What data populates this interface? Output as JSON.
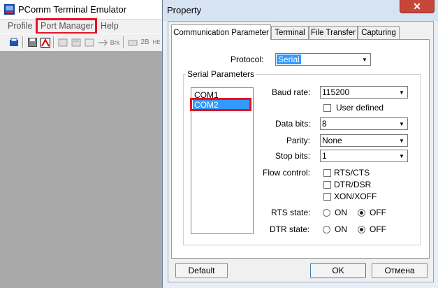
{
  "app": {
    "title": "PComm Terminal Emulator",
    "menu": [
      "Profile",
      "Port Manager",
      "Help"
    ],
    "toolbar": {
      "brk_label": "Brk",
      "twob_label": "2B",
      "he_label": "HE"
    }
  },
  "dialog": {
    "title": "Property",
    "close_glyph": "✕",
    "tabs": [
      "Communication Parameter",
      "Terminal",
      "File Transfer",
      "Capturing"
    ],
    "protocol": {
      "label": "Protocol:",
      "value": "Serial"
    },
    "serial_group_label": "Serial Parameters",
    "ports": [
      "COM1",
      "COM2"
    ],
    "selected_port": "COM2",
    "baud_rate": {
      "label": "Baud rate:",
      "value": "115200"
    },
    "user_defined_label": "User defined",
    "data_bits": {
      "label": "Data bits:",
      "value": "8"
    },
    "parity": {
      "label": "Parity:",
      "value": "None"
    },
    "stop_bits": {
      "label": "Stop bits:",
      "value": "1"
    },
    "flow_control": {
      "label": "Flow control:",
      "options": [
        "RTS/CTS",
        "DTR/DSR",
        "XON/XOFF"
      ]
    },
    "rts_state": {
      "label": "RTS state:",
      "on": "ON",
      "off": "OFF",
      "selected": "OFF"
    },
    "dtr_state": {
      "label": "DTR state:",
      "on": "ON",
      "off": "OFF",
      "selected": "OFF"
    },
    "buttons": {
      "default": "Default",
      "ok": "OK",
      "cancel": "Отмена"
    }
  },
  "colors": {
    "highlight": "#e81123",
    "selection": "#3399ff",
    "workspace": "#a9a9a9"
  }
}
